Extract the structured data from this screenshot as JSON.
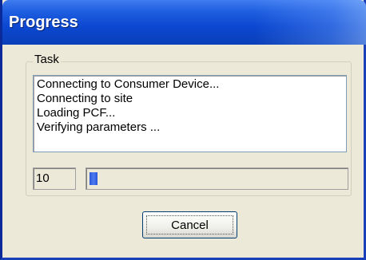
{
  "window": {
    "title": "Progress"
  },
  "group": {
    "label": "Task"
  },
  "log": {
    "lines": [
      "Connecting to Consumer Device...",
      "Connecting to site",
      "Loading PCF...",
      "Verifying parameters ..."
    ]
  },
  "progress": {
    "value_text": "10",
    "fraction": 0.03
  },
  "buttons": {
    "cancel_label": "Cancel"
  },
  "colors": {
    "titlebar": "#0b47d0",
    "progress_fill": "#2a56d8",
    "window_bg": "#ece9d8"
  }
}
